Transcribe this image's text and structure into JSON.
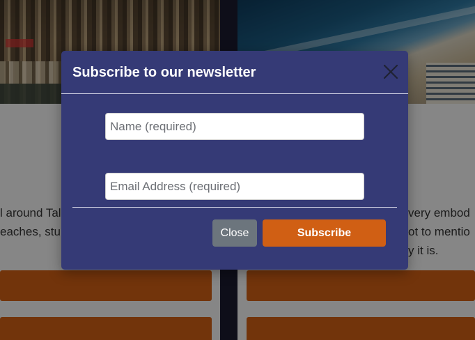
{
  "background": {
    "left_text_lines": [
      "l around Tal",
      "eaches, stun"
    ],
    "right_text_lines": [
      "very embod",
      "ot to mentio",
      "y it is."
    ]
  },
  "modal": {
    "title": "Subscribe to our newsletter",
    "close_icon": "close-icon",
    "name_field": {
      "placeholder": "Name (required)",
      "value": ""
    },
    "email_field": {
      "placeholder": "Email Address (required)",
      "value": ""
    },
    "close_label": "Close",
    "subscribe_label": "Subscribe"
  },
  "colors": {
    "modal_bg": "#353a76",
    "subscribe_button": "#d05f14",
    "close_button": "#6c757d"
  }
}
